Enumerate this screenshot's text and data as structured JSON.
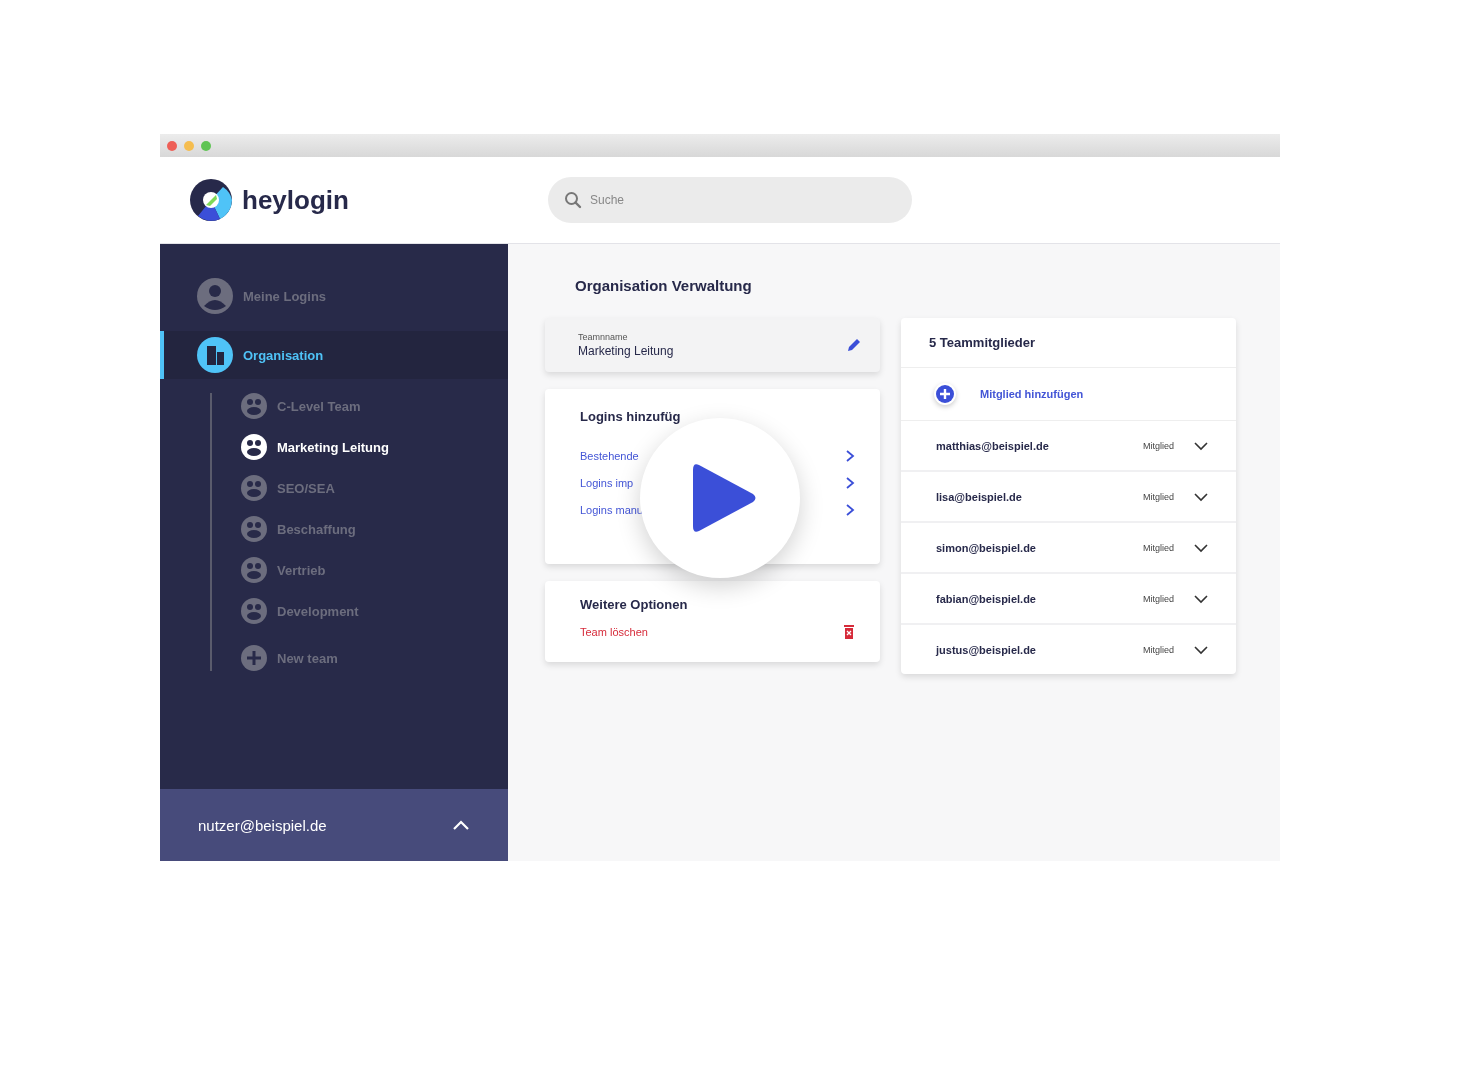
{
  "window": {
    "title_bar": {
      "controls": [
        {
          "color": "#ee5f57"
        },
        {
          "color": "#f5bd4f"
        },
        {
          "color": "#5fc454"
        }
      ]
    }
  },
  "header": {
    "brand": "heylogin",
    "search": {
      "placeholder": "Suche"
    }
  },
  "sidebar": {
    "items": [
      {
        "label": "Meine Logins",
        "kind": "user",
        "selected": false
      },
      {
        "label": "Organisation",
        "kind": "org",
        "selected": true,
        "children": [
          {
            "label": "C-Level Team",
            "kind": "team",
            "selected": false
          },
          {
            "label": "Marketing Leitung",
            "kind": "team",
            "selected": true
          },
          {
            "label": "SEO/SEA",
            "kind": "team",
            "selected": false
          },
          {
            "label": "Beschaffung",
            "kind": "team",
            "selected": false
          },
          {
            "label": "Vertrieb",
            "kind": "team",
            "selected": false
          },
          {
            "label": "Development",
            "kind": "team",
            "selected": false
          },
          {
            "label": "New team",
            "kind": "add",
            "selected": false
          }
        ]
      }
    ],
    "account": {
      "email": "nutzer@beispiel.de"
    }
  },
  "main": {
    "title": "Organisation Verwaltung",
    "team_name": {
      "label": "Teamnname",
      "value": "Marketing Leitung"
    },
    "add_logins": {
      "title": "Logins hinzufüg",
      "links": [
        "Bestehende",
        "Logins imp",
        "Logins manu"
      ]
    },
    "more_options": {
      "title": "Weitere Optionen",
      "delete": "Team löschen"
    },
    "members": {
      "title": "5 Teammitglieder",
      "add": "Mitglied hinzufügen",
      "rows": [
        {
          "email": "matthias@beispiel.de",
          "role": "Mitglied"
        },
        {
          "email": "lisa@beispiel.de",
          "role": "Mitglied"
        },
        {
          "email": "simon@beispiel.de",
          "role": "Mitglied"
        },
        {
          "email": "fabian@beispiel.de",
          "role": "Mitglied"
        },
        {
          "email": "justus@beispiel.de",
          "role": "Mitglied"
        }
      ]
    }
  }
}
